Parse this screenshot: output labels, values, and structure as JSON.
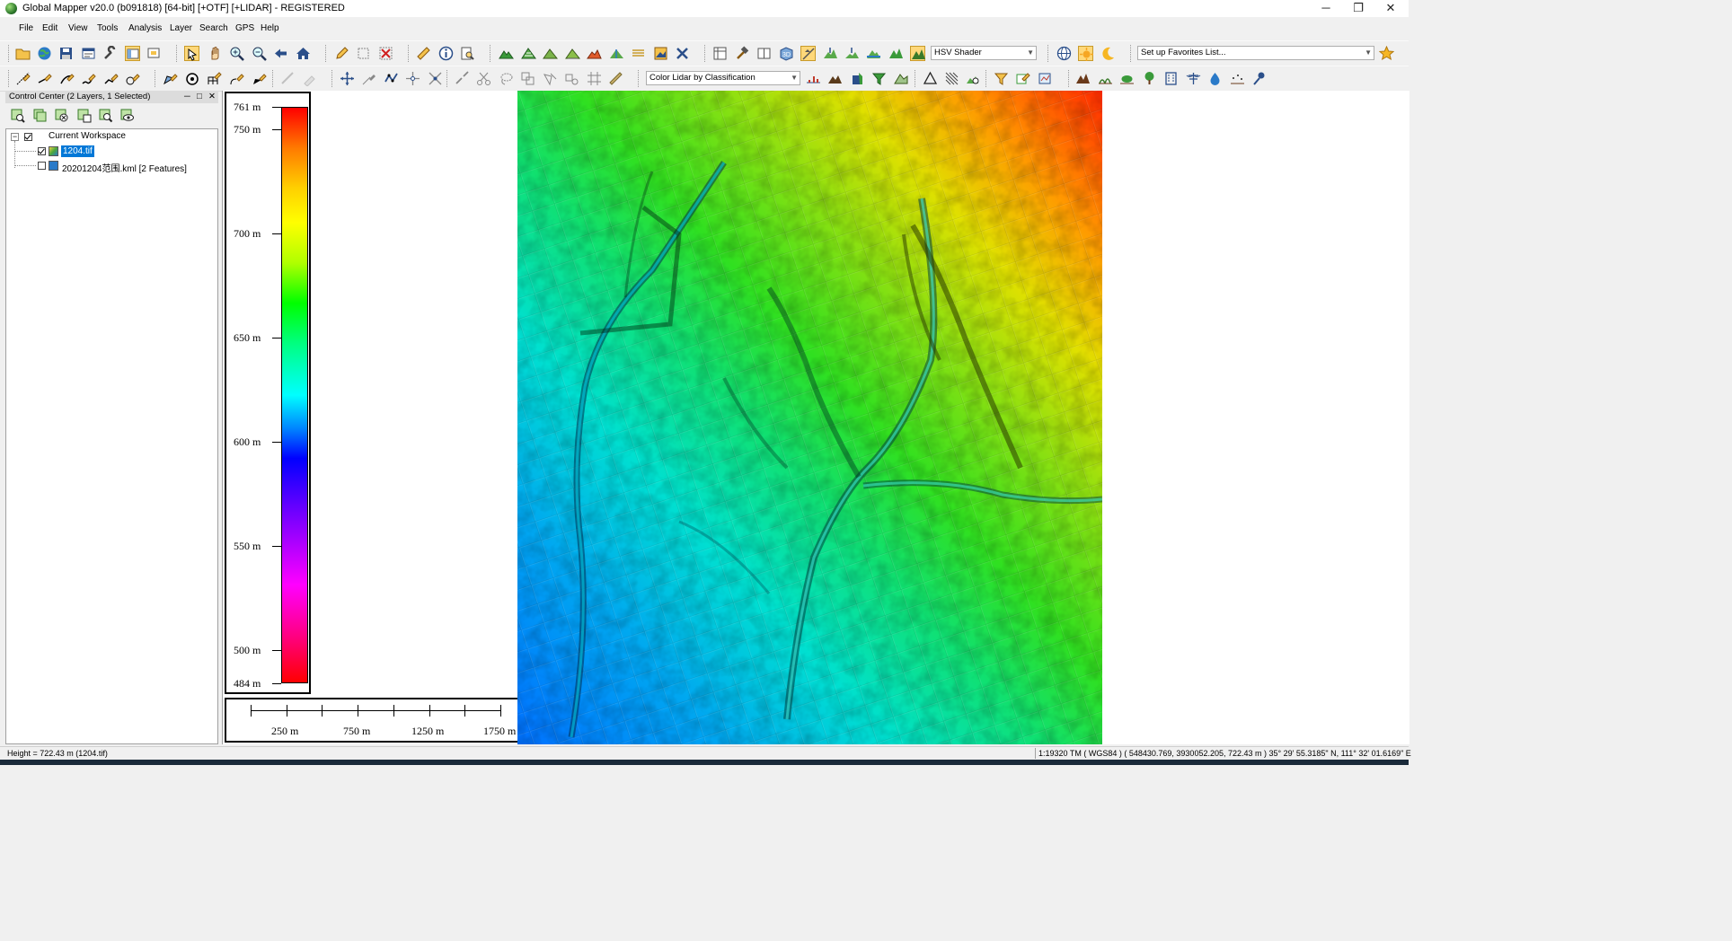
{
  "window": {
    "title": "Global Mapper v20.0 (b091818) [64-bit] [+OTF] [+LIDAR] - REGISTERED",
    "minimize": "─",
    "restore": "❐",
    "close": "✕"
  },
  "menu": [
    "File",
    "Edit",
    "View",
    "Tools",
    "Analysis",
    "Layer",
    "Search",
    "GPS",
    "Help"
  ],
  "toolbar": {
    "shader_select": "HSV Shader",
    "favorites_select": "Set up Favorites List...",
    "lidar_color_select": "Color Lidar by Classification"
  },
  "control_center": {
    "title": "Control Center (2 Layers, 1 Selected)",
    "pin": "─",
    "float": "□",
    "close": "✕",
    "tree": {
      "root_label": "Current Workspace",
      "expander": "−",
      "layers": [
        {
          "label": "1204.tif",
          "checked": true,
          "selected": true
        },
        {
          "label": "20201204范围.kml [2 Features]",
          "checked": false,
          "selected": false
        }
      ]
    }
  },
  "legend": {
    "labels": [
      "761 m",
      "750 m",
      "700 m",
      "650 m",
      "600 m",
      "550 m",
      "500 m",
      "484 m"
    ],
    "values": [
      761,
      750,
      700,
      650,
      600,
      550,
      500,
      484
    ],
    "min": 484,
    "max": 761
  },
  "scale_bar": {
    "labels": [
      "250 m",
      "750 m",
      "1250 m",
      "1750 m"
    ]
  },
  "status": {
    "left": "Height = 722.43 m (1204.tif)",
    "right": "1:19320  TM ( WGS84 ) ( 548430.769, 3930052.205, 722.43 m )  35° 29' 55.3185\" N, 111° 32' 01.6169\" E"
  },
  "colors": {
    "selection": "#0078d7",
    "accent_toolbar_pressed": "#ffd87a"
  }
}
